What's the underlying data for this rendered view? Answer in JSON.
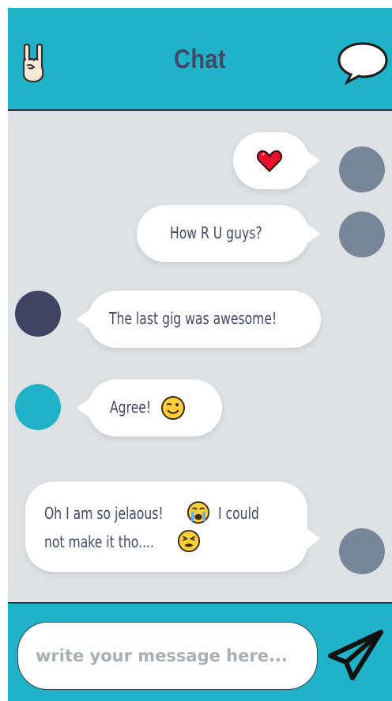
{
  "header": {
    "title": "Chat",
    "left_icon": "rock-hand-icon",
    "right_icon": "speech-bubble-icon"
  },
  "messages": [
    {
      "side": "right",
      "text": "",
      "emoji": [
        "heart-icon"
      ],
      "avatar_color": "#778699"
    },
    {
      "side": "right",
      "text": "How R U guys?",
      "avatar_color": "#778699"
    },
    {
      "side": "left",
      "text": "The last gig was awesome!",
      "avatar_color": "#3f4463"
    },
    {
      "side": "left",
      "text": "Agree!",
      "emoji": [
        "winking-face-icon"
      ],
      "avatar_color": "#1fb2c8"
    },
    {
      "side": "right",
      "line1_a": "Oh I am so jelaous!",
      "line1_b": "I could",
      "line2": "not make it tho....",
      "emoji": [
        "crying-face-icon",
        "tired-face-icon"
      ],
      "avatar_color": "#778699"
    }
  ],
  "composer": {
    "placeholder": "write your message here...",
    "send_icon": "paper-plane-icon"
  },
  "colors": {
    "accent": "#1fb2c8",
    "background": "#dfe2e5",
    "title": "#414868",
    "avatar_gray": "#778699",
    "avatar_dark": "#3f4463"
  }
}
